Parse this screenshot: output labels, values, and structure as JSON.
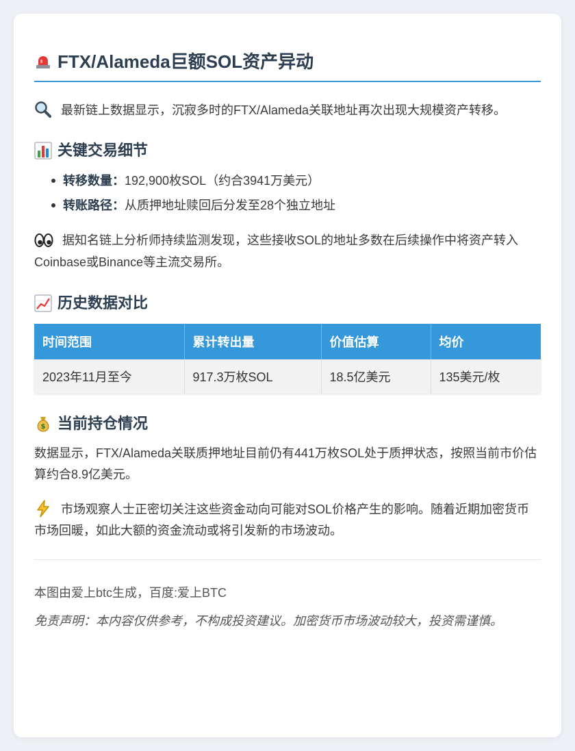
{
  "title": {
    "icon": "rotating-light-icon",
    "text": "FTX/Alameda巨额SOL资产异动"
  },
  "intro": {
    "icon": "magnifier-icon",
    "text": "最新链上数据显示，沉寂多时的FTX/Alameda关联地址再次出现大规模资产转移。"
  },
  "details": {
    "icon": "bar-chart-icon",
    "heading": "关键交易细节",
    "items": [
      {
        "label": "转移数量：",
        "value": "192,900枚SOL（约合3941万美元）"
      },
      {
        "label": "转账路径：",
        "value": "从质押地址赎回后分发至28个独立地址"
      }
    ]
  },
  "analysis": {
    "icon": "eyes-icon",
    "text": "据知名链上分析师持续监测发现，这些接收SOL的地址多数在后续操作中将资产转入Coinbase或Binance等主流交易所。"
  },
  "history": {
    "icon": "trending-up-chart-icon",
    "heading": "历史数据对比",
    "table": {
      "headers": [
        "时间范围",
        "累计转出量",
        "价值估算",
        "均价"
      ],
      "rows": [
        [
          "2023年11月至今",
          "917.3万枚SOL",
          "18.5亿美元",
          "135美元/枚"
        ]
      ]
    }
  },
  "holdings": {
    "icon": "money-bag-icon",
    "heading": "当前持仓情况",
    "text": "数据显示，FTX/Alameda关联质押地址目前仍有441万枚SOL处于质押状态，按照当前市价估算约合8.9亿美元。"
  },
  "market": {
    "icon": "lightning-icon",
    "text": "市场观察人士正密切关注这些资金动向可能对SOL价格产生的影响。随着近期加密货币市场回暖，如此大额的资金流动或将引发新的市场波动。"
  },
  "footer": {
    "note": "本图由爱上btc生成，百度:爱上BTC",
    "disclaimer": "免责声明：本内容仅供参考，不构成投资建议。加密货币市场波动较大，投资需谨慎。"
  },
  "colors": {
    "accent": "#3498db",
    "heading": "#2c3e50",
    "background": "#edf0f4"
  }
}
